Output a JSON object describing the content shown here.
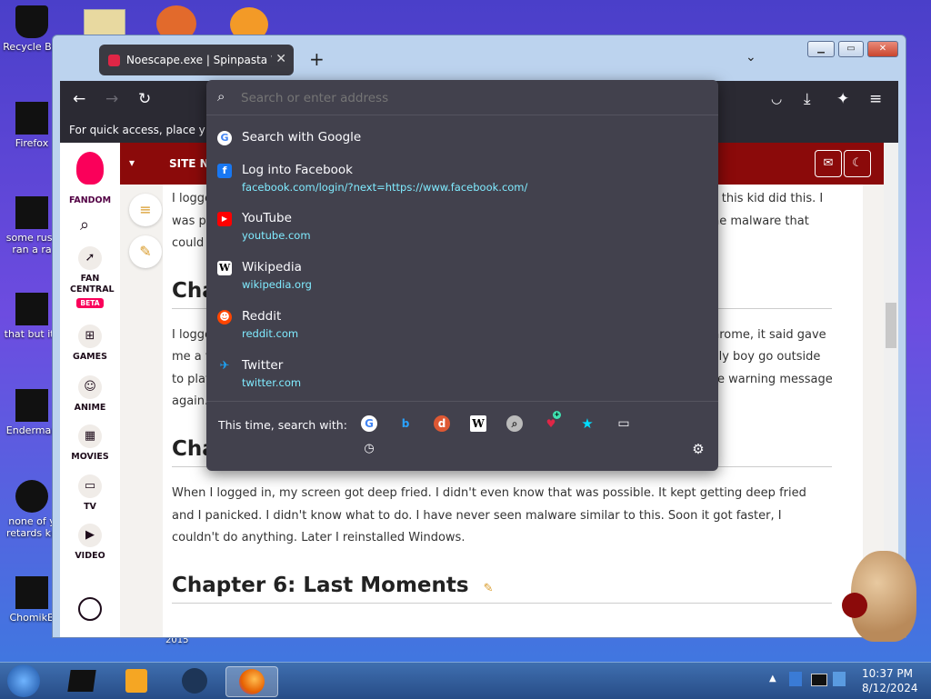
{
  "desktop": {
    "icons": [
      {
        "label": "Recycle Bin"
      },
      {
        "label": "Firefox"
      },
      {
        "label": "some russ"
      },
      {
        "label": "ran a ra"
      },
      {
        "label": "that but its"
      },
      {
        "label": "Enderman"
      },
      {
        "label": "none of y"
      },
      {
        "label": "retards kn"
      },
      {
        "label": "ChomikB"
      }
    ],
    "stray_label": "2015"
  },
  "browser": {
    "tab": {
      "title": "Noescape.exe | Spinpasta Wiki |"
    },
    "new_tab_glyph": "+",
    "bookmarks_toolbar_text": "For quick access, place your b",
    "url_panel": {
      "placeholder": "Search or enter address",
      "suggestions": [
        {
          "title": "Search with Google",
          "url": "",
          "icon": "google-icon"
        },
        {
          "title": "Log into Facebook",
          "url": "facebook.com/login/?next=https://www.facebook.com/",
          "icon": "facebook-icon"
        },
        {
          "title": "YouTube",
          "url": "youtube.com",
          "icon": "youtube-icon"
        },
        {
          "title": "Wikipedia",
          "url": "wikipedia.org",
          "icon": "wikipedia-icon"
        },
        {
          "title": "Reddit",
          "url": "reddit.com",
          "icon": "reddit-icon"
        },
        {
          "title": "Twitter",
          "url": "twitter.com",
          "icon": "twitter-icon"
        }
      ],
      "search_with_label": "This time, search with:",
      "engines": [
        "google-icon",
        "bing-icon",
        "duckduckgo-icon",
        "wikipedia-icon",
        "search-icon",
        "add-engine-icon",
        "bookmarks-star-icon",
        "tabs-icon",
        "history-icon"
      ]
    }
  },
  "page": {
    "fandom_label": "FANDOM",
    "sidebar": [
      {
        "label": "FAN CENTRAL"
      },
      {
        "label": "BETA"
      },
      {
        "label": "GAMES"
      },
      {
        "label": "ANIME"
      },
      {
        "label": "MOVIES"
      },
      {
        "label": "TV"
      },
      {
        "label": "VIDEO"
      }
    ],
    "site_nav_label": "SITE NA",
    "paragraphs": {
      "p1_left": "I logge",
      "p1_right": "w this kid did this. I",
      "p1_l2_left": "was pa",
      "p1_l2_right": "he malware that",
      "p1_l3_left": "could",
      "h_chapter_partial": "Cha",
      "p2_l1_left": "I logge",
      "p2_l1_right": "hrome, it said gave",
      "p2_l2_left": "me a v",
      "p2_l2_right": "lly boy go outside",
      "p2_l3_left": "to play",
      "p2_l3_right": "e warning message",
      "p2_l4_left": "again.",
      "h_chapter5_partial": "Chap",
      "p3": "When I logged in, my screen got deep fried. I didn't even know that was possible. It kept getting deep fried and I panicked. I didn't know what to do. I have never seen malware similar to this. Soon it got faster, I couldn't do anything. Later I reinstalled Windows.",
      "h_chapter6": "Chapter 6: Last Moments"
    }
  },
  "taskbar": {
    "time": "10:37 PM",
    "date": "8/12/2024"
  },
  "colors": {
    "accent_red": "#8b0a0a",
    "fandom_pink": "#fa005a",
    "panel_bg": "#42414d",
    "link_cyan": "#80ebff"
  }
}
